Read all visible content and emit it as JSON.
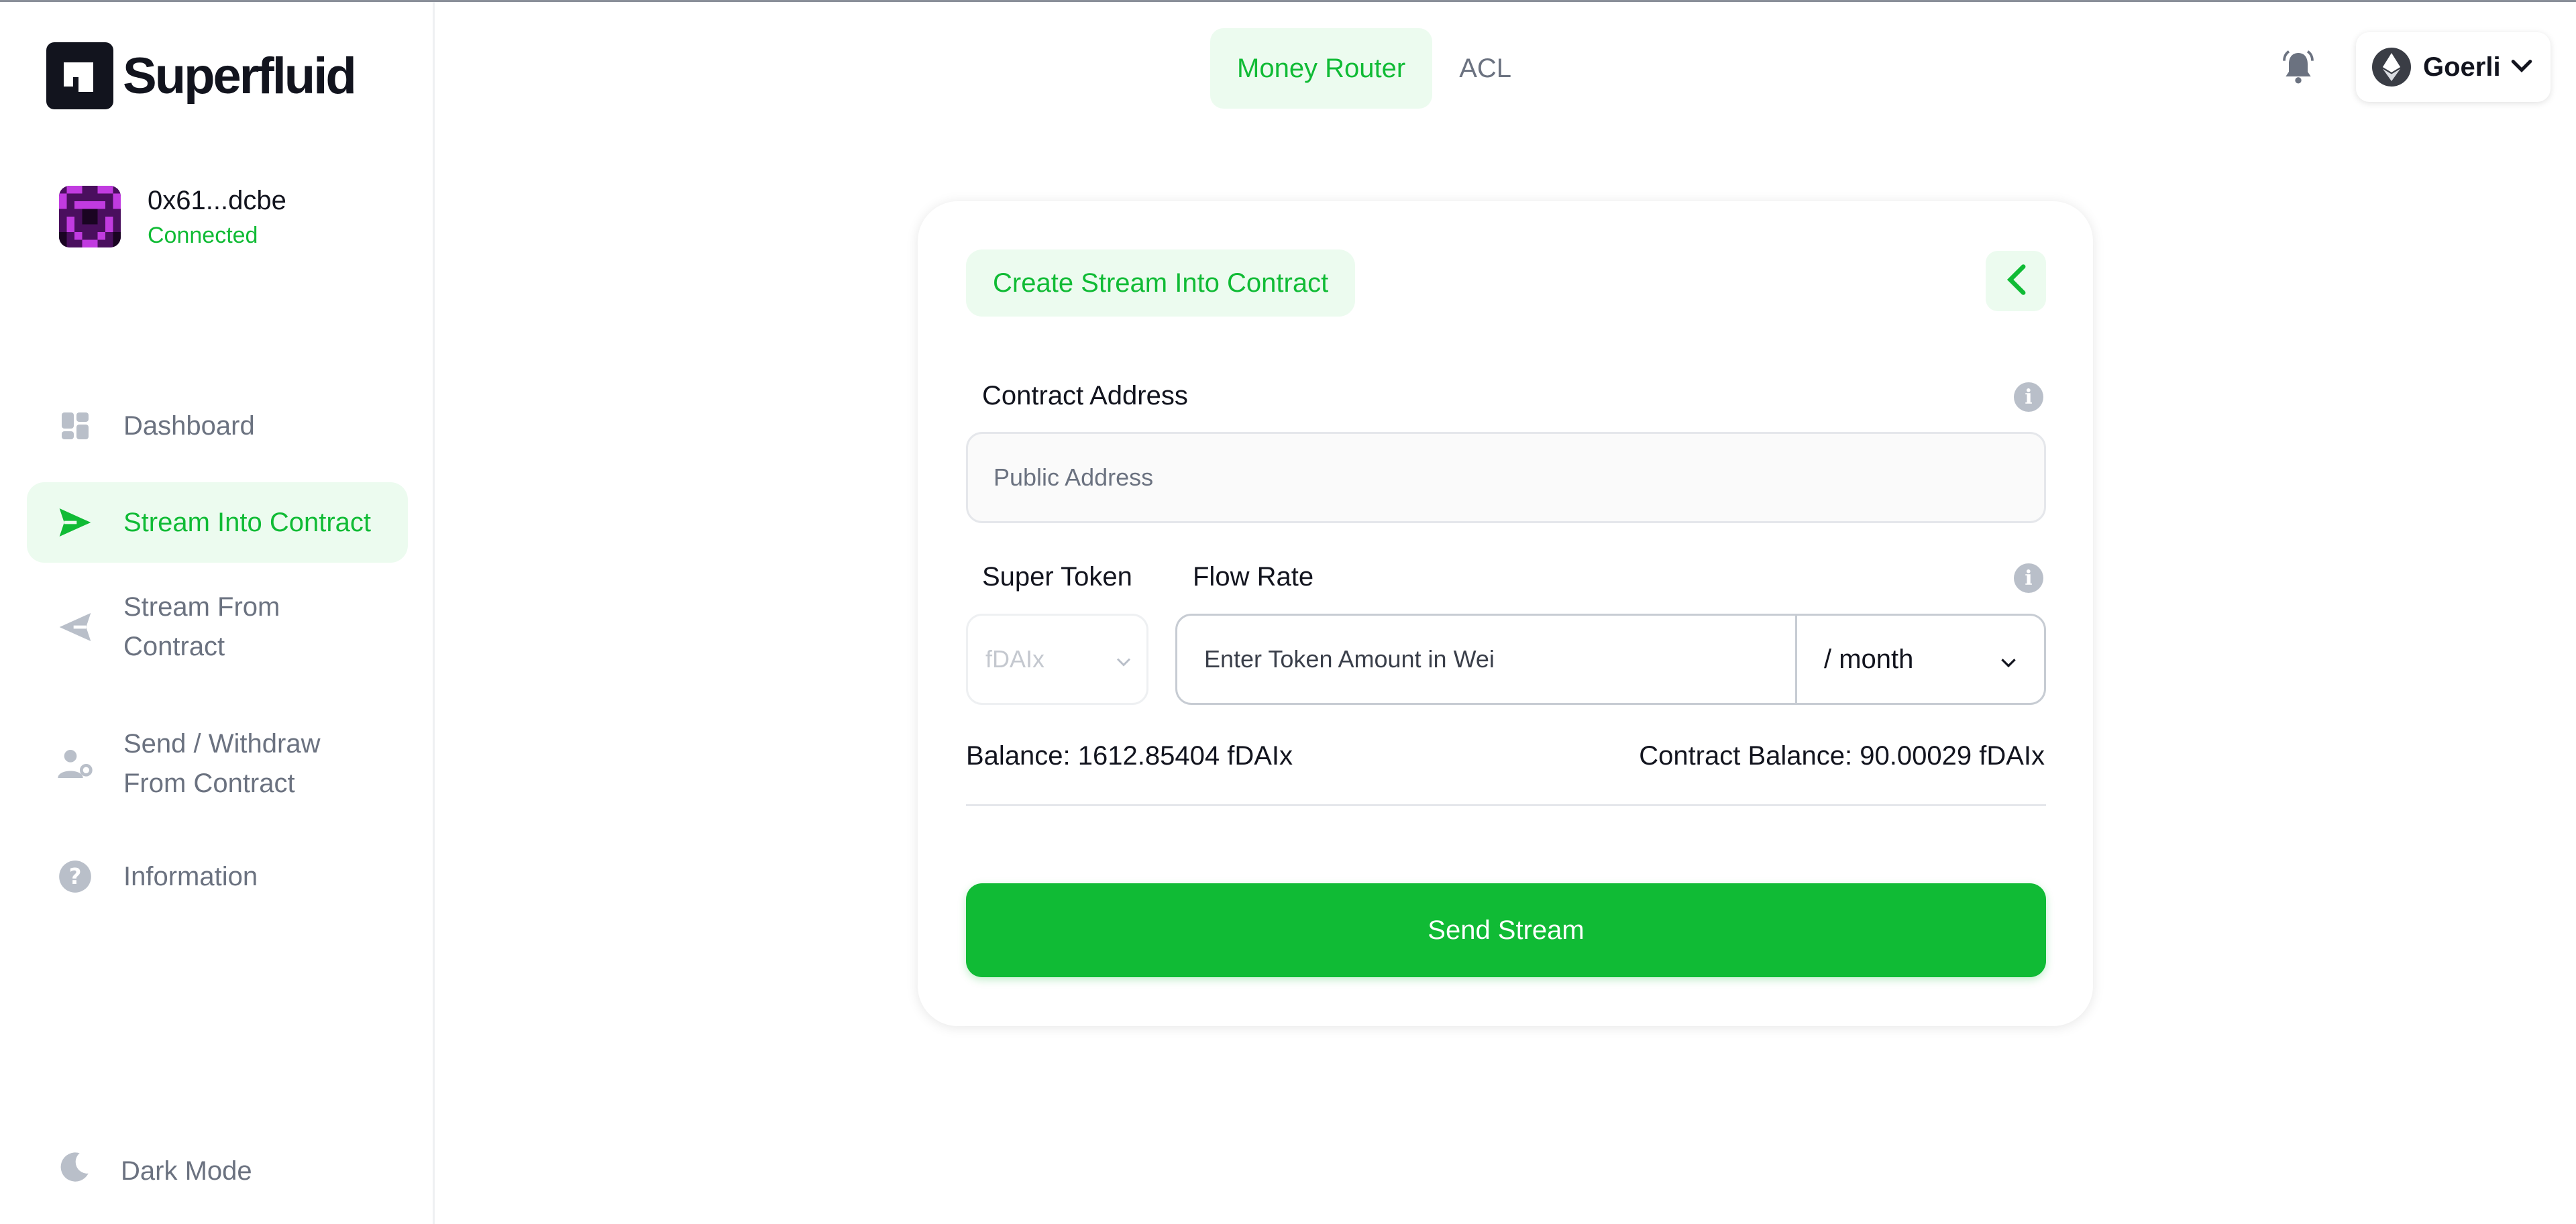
{
  "brand": {
    "name": "Superfluid"
  },
  "account": {
    "address": "0x61...dcbe",
    "status": "Connected"
  },
  "nav": {
    "items": [
      {
        "label": "Dashboard",
        "icon": "dashboard-icon",
        "active": false
      },
      {
        "label": "Stream Into Contract",
        "icon": "send-icon",
        "active": true
      },
      {
        "label": "Stream From Contract",
        "icon": "receive-icon",
        "active": false
      },
      {
        "label": "Send / Withdraw From Contract",
        "icon": "user-settings-icon",
        "active": false
      },
      {
        "label": "Information",
        "icon": "help-icon",
        "active": false
      }
    ],
    "dark_mode": "Dark Mode"
  },
  "header": {
    "tabs": [
      {
        "label": "Money Router",
        "active": true
      },
      {
        "label": "ACL",
        "active": false
      }
    ],
    "network": "Goerli"
  },
  "form": {
    "badge": "Create Stream Into Contract",
    "contract_address_label": "Contract Address",
    "contract_address_placeholder": "Public Address",
    "super_token_label": "Super Token",
    "super_token_value": "fDAIx",
    "flow_rate_label": "Flow Rate",
    "flow_rate_placeholder": "Enter Token Amount in Wei",
    "period": "/ month",
    "balance": "Balance: 1612.85404 fDAIx",
    "contract_balance": "Contract Balance: 90.00029 fDAIx",
    "submit": "Send Stream"
  },
  "colors": {
    "accent": "#10bb35",
    "accent_bg": "#ecfbef",
    "muted": "#6b7280"
  }
}
